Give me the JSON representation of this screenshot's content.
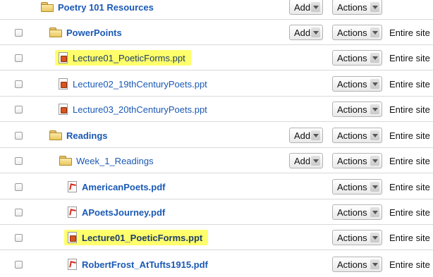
{
  "buttons": {
    "add": "Add",
    "actions": "Actions"
  },
  "rows": [
    {
      "type": "folder",
      "label": "Poetry 101 Resources",
      "scope": ""
    },
    {
      "type": "folder",
      "label": "PowerPoints",
      "scope": "Entire site"
    },
    {
      "type": "ppt",
      "label": "Lecture01_PoeticForms.ppt",
      "scope": "Entire site",
      "highlighted": true
    },
    {
      "type": "ppt",
      "label": "Lecture02_19thCenturyPoets.ppt",
      "scope": "Entire site"
    },
    {
      "type": "ppt",
      "label": "Lecture03_20thCenturyPoets.ppt",
      "scope": "Entire site"
    },
    {
      "type": "folder",
      "label": "Readings",
      "scope": "Entire site"
    },
    {
      "type": "folder",
      "label": "Week_1_Readings",
      "scope": "Entire site"
    },
    {
      "type": "pdf",
      "label": "AmericanPoets.pdf",
      "scope": "Entire site"
    },
    {
      "type": "pdf",
      "label": "APoetsJourney.pdf",
      "scope": "Entire site"
    },
    {
      "type": "ppt",
      "label": "Lecture01_PoeticForms.ppt",
      "scope": "Entire site",
      "highlighted": true
    },
    {
      "type": "pdf",
      "label": "RobertFrost_AtTufts1915.pdf",
      "scope": "Entire site"
    }
  ],
  "colors": {
    "highlight": "#ffff6b",
    "link": "#1a59b5"
  }
}
